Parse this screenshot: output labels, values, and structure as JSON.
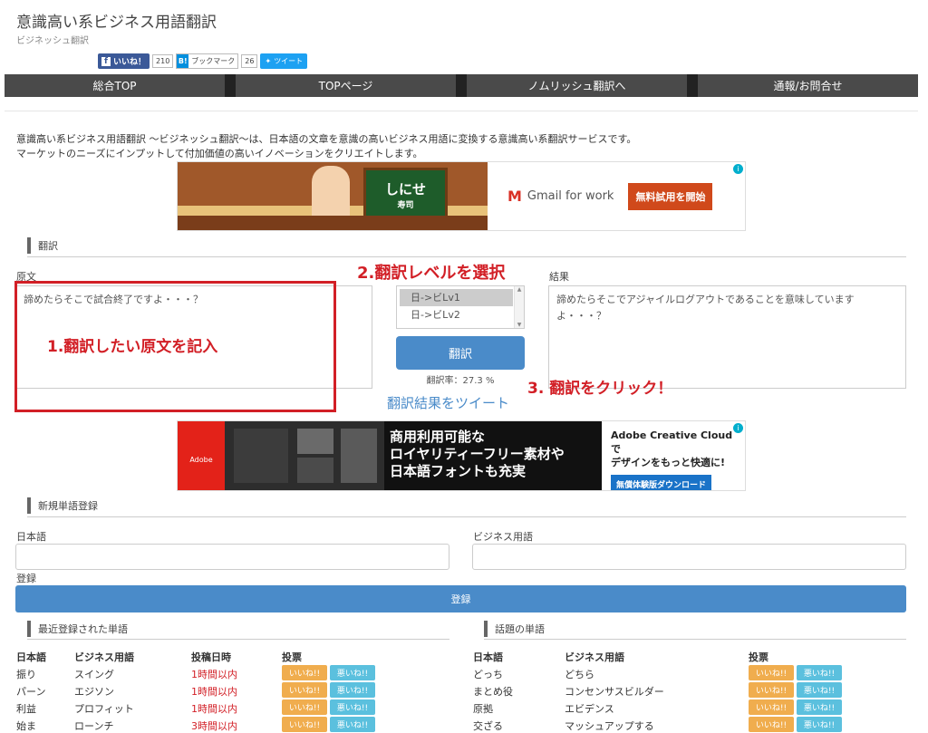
{
  "header": {
    "title": "意識高い系ビジネス用語翻訳",
    "subtitle": "ビジネッシュ翻訳"
  },
  "social": {
    "like_label": "いいね！",
    "like_count": "210",
    "hatena_label": "ブックマーク",
    "hatena_count": "26",
    "tweet_label": "ツイート"
  },
  "nav": {
    "items": [
      "総合TOP",
      "TOPページ",
      "ノムリッシュ翻訳へ",
      "通報/お問合せ"
    ]
  },
  "intro": {
    "line1": "意識高い系ビジネス用語翻訳 〜ビジネッシュ翻訳〜は、日本語の文章を意識の高いビジネス用語に変換する意識高い系翻訳サービスです。",
    "line2": "マーケットのニーズにインプットして付加価値の高いイノベーションをクリエイトします。"
  },
  "ad1": {
    "sign": "しにせ",
    "sign_sub": "寿司",
    "brand": "Gmail for work",
    "cta": "無料試用を開始"
  },
  "translate": {
    "section_title": "翻訳",
    "source_label": "原文",
    "source_text": "諦めたらそこで試合終了ですよ・・・？",
    "result_label": "結果",
    "result_text": "諦めたらそこでアジャイルログアウトであることを意味していますよ・・・？",
    "levels": [
      "日->ビLv1",
      "日->ビLv2"
    ],
    "button": "翻訳",
    "rate": "翻訳率：27.3 %",
    "tweet_link": "翻訳結果をツイート"
  },
  "annotations": {
    "step1": "1.翻訳したい原文を記入",
    "step2": "2.翻訳レベルを選択",
    "step3": "3. 翻訳をクリック！"
  },
  "ad2": {
    "logo": "Adobe",
    "copy1": "商用利用可能な",
    "copy2": "ロイヤリティーフリー素材や",
    "copy3": "日本語フォントも充実",
    "right1": "Adobe Creative Cloudで",
    "right2": "デザインをもっと快適に!",
    "cta": "無償体験版ダウンロード"
  },
  "register": {
    "section_title": "新規単語登録",
    "japanese_label": "日本語",
    "business_label": "ビジネス用語",
    "submit_label": "登録",
    "button": "登録"
  },
  "recent": {
    "section_title": "最近登録された単語",
    "headers": [
      "日本語",
      "ビジネス用語",
      "投稿日時",
      "投票"
    ],
    "rows": [
      {
        "ja": "振り",
        "biz": "スイング",
        "time": "1時間以内"
      },
      {
        "ja": "パーン",
        "biz": "エジソン",
        "time": "1時間以内"
      },
      {
        "ja": "利益",
        "biz": "プロフィット",
        "time": "1時間以内"
      },
      {
        "ja": "始ま",
        "biz": "ローンチ",
        "time": "3時間以内"
      }
    ],
    "good": "いいね!!",
    "bad": "悪いね!!"
  },
  "popular": {
    "section_title": "話題の単語",
    "headers": [
      "日本語",
      "ビジネス用語",
      "投票"
    ],
    "rows": [
      {
        "ja": "どっち",
        "biz": "どちら"
      },
      {
        "ja": "まとめ役",
        "biz": "コンセンサスビルダー"
      },
      {
        "ja": "原拠",
        "biz": "エビデンス"
      },
      {
        "ja": "交ざる",
        "biz": "マッシュアップする"
      }
    ],
    "good": "いいね!!",
    "bad": "悪いね!!"
  }
}
